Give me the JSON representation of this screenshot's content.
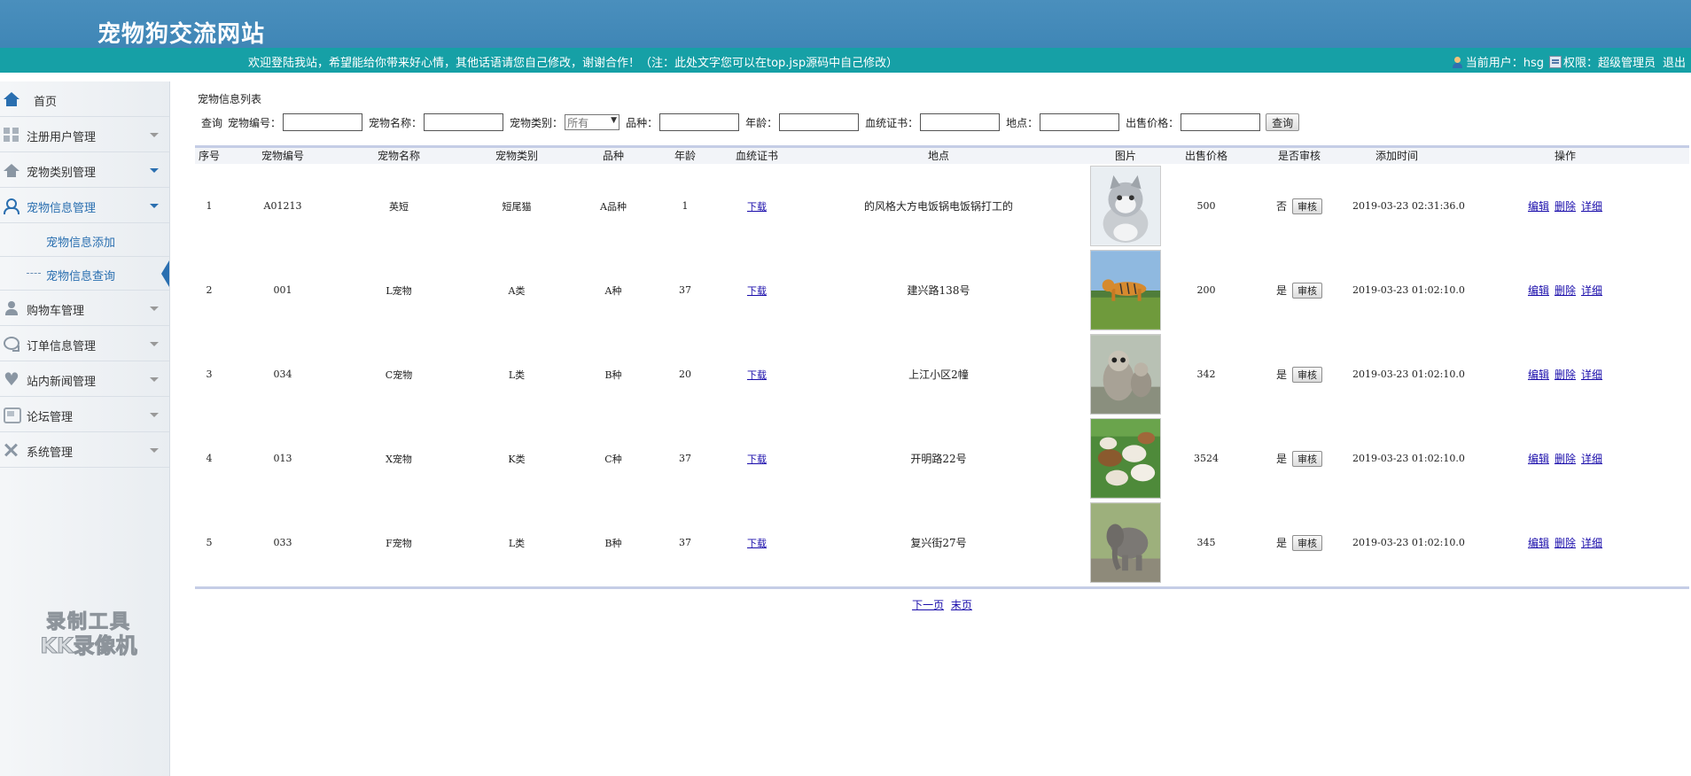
{
  "site_title": "宠物狗交流网站",
  "topbar": {
    "welcome": "欢迎登陆我站，希望能给你带来好心情，其他话语请您自己修改，谢谢合作！（注：此处文字您可以在top.jsp源码中自己修改）",
    "current_user_label": "当前用户：hsg",
    "permission_label": "权限：超级管理员",
    "logout_label": "退出"
  },
  "sidebar": {
    "items": [
      {
        "label": "首页",
        "icon": "home-icon"
      },
      {
        "label": "注册用户管理",
        "icon": "grid-icon"
      },
      {
        "label": "宠物类别管理",
        "icon": "house-icon"
      },
      {
        "label": "宠物信息管理",
        "icon": "users-icon"
      },
      {
        "label": "购物车管理",
        "icon": "person-icon"
      },
      {
        "label": "订单信息管理",
        "icon": "chat-icon"
      },
      {
        "label": "站内新闻管理",
        "icon": "heart-icon"
      },
      {
        "label": "论坛管理",
        "icon": "forum-icon"
      },
      {
        "label": "系统管理",
        "icon": "tools-icon"
      }
    ],
    "subitems": [
      {
        "label": "宠物信息添加"
      },
      {
        "label": "宠物信息查询"
      }
    ]
  },
  "watermark": {
    "line1": "录制工具",
    "line2": "KK录像机"
  },
  "content": {
    "section_title": "宠物信息列表",
    "search": {
      "query_label": "查询",
      "fields": [
        {
          "label": "宠物编号：",
          "value": ""
        },
        {
          "label": "宠物名称：",
          "value": ""
        },
        {
          "label": "宠物类别：",
          "value": "所有"
        },
        {
          "label": "品种：",
          "value": ""
        },
        {
          "label": "年龄：",
          "value": ""
        },
        {
          "label": "血统证书：",
          "value": ""
        },
        {
          "label": "地点：",
          "value": ""
        },
        {
          "label": "出售价格：",
          "value": ""
        }
      ],
      "button": "查询"
    },
    "table": {
      "headers": [
        "序号",
        "宠物编号",
        "宠物名称",
        "宠物类别",
        "品种",
        "年龄",
        "血统证书",
        "地点",
        "图片",
        "出售价格",
        "是否审核",
        "添加时间",
        "操作"
      ],
      "rows": [
        {
          "no": "1",
          "code": "A01213",
          "name": "英短",
          "category": "短尾猫",
          "breed": "A品种",
          "age": "1",
          "cert": "下载",
          "location": "的风格大方电饭锅电饭锅打工的",
          "photo": "kitten",
          "price": "500",
          "audited": "否",
          "audit_btn": "审核",
          "time": "2019-03-23 02:31:36.0",
          "ops": [
            "编辑",
            "删除",
            "详细"
          ]
        },
        {
          "no": "2",
          "code": "001",
          "name": "L宠物",
          "category": "A类",
          "breed": "A种",
          "age": "37",
          "cert": "下载",
          "location": "建兴路138号",
          "photo": "tiger",
          "price": "200",
          "audited": "是",
          "audit_btn": "审核",
          "time": "2019-03-23 01:02:10.0",
          "ops": [
            "编辑",
            "删除",
            "详细"
          ]
        },
        {
          "no": "3",
          "code": "034",
          "name": "C宠物",
          "category": "L类",
          "breed": "B种",
          "age": "20",
          "cert": "下载",
          "location": "上江小区2幢",
          "photo": "owl",
          "price": "342",
          "audited": "是",
          "audit_btn": "审核",
          "time": "2019-03-23 01:02:10.0",
          "ops": [
            "编辑",
            "删除",
            "详细"
          ]
        },
        {
          "no": "4",
          "code": "013",
          "name": "X宠物",
          "category": "K类",
          "breed": "C种",
          "age": "37",
          "cert": "下载",
          "location": "开明路22号",
          "photo": "sheep",
          "price": "3524",
          "audited": "是",
          "audit_btn": "审核",
          "time": "2019-03-23 01:02:10.0",
          "ops": [
            "编辑",
            "删除",
            "详细"
          ]
        },
        {
          "no": "5",
          "code": "033",
          "name": "F宠物",
          "category": "L类",
          "breed": "B种",
          "age": "37",
          "cert": "下载",
          "location": "复兴街27号",
          "photo": "elephant",
          "price": "345",
          "audited": "是",
          "audit_btn": "审核",
          "time": "2019-03-23 01:02:10.0",
          "ops": [
            "编辑",
            "删除",
            "详细"
          ]
        }
      ]
    },
    "pager": {
      "next": "下一页",
      "last": "末页"
    }
  }
}
